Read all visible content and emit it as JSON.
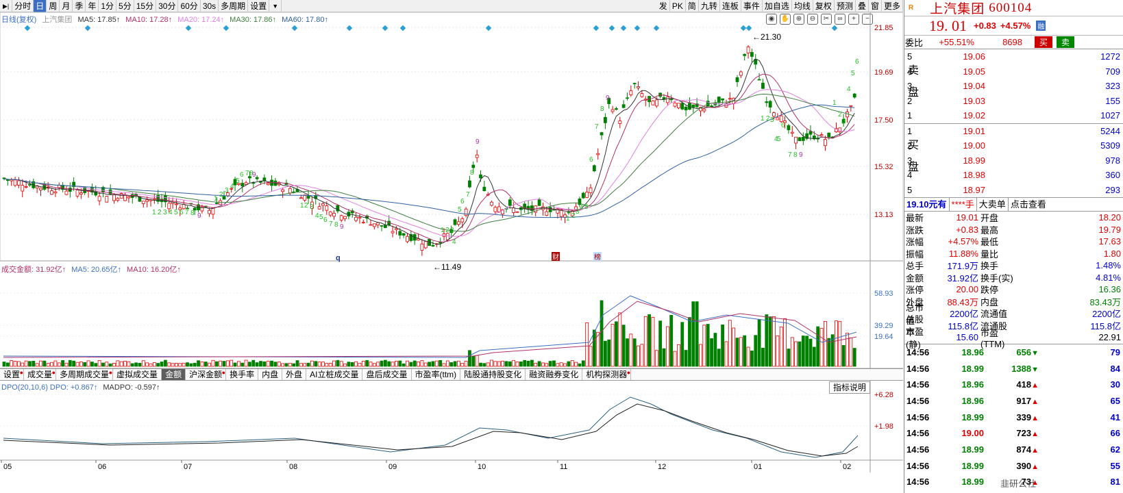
{
  "toolbar": {
    "left_items": [
      "分时",
      "日",
      "周",
      "月",
      "季",
      "年",
      "1分",
      "5分",
      "15分",
      "30分",
      "60分",
      "30s",
      "多周期",
      "设置"
    ],
    "active_index": 1,
    "right_items": [
      "发",
      "PK",
      "简",
      "九转",
      "连板",
      "事件",
      "加自选",
      "均线",
      "复权",
      "预测",
      "叠",
      "窗",
      "更多"
    ]
  },
  "price_legend": {
    "label": "日线(复权)",
    "stock": "上汽集团",
    "ma5": "MA5: 17.85↑",
    "ma10": "MA10: 17.28↑",
    "ma20": "MA20: 17.24↑",
    "ma30": "MA30: 17.86↑",
    "ma60": "MA60: 17.80↑"
  },
  "price_axis": [
    "21.85",
    "19.69",
    "17.50",
    "15.32",
    "13.13"
  ],
  "annotations": {
    "high": "21.30",
    "low": "11.49",
    "letter_q": "q",
    "badge_cai": "财",
    "badge_bang": "榜"
  },
  "volume_legend": {
    "label": "成交金额: 31.92亿↑",
    "ma5": "MA5: 20.65亿↑",
    "ma10": "MA10: 16.20亿↑"
  },
  "volume_axis": [
    "58.93",
    "39.29",
    "19.64"
  ],
  "indicator_tabs": [
    "设置",
    "成交量",
    "多周期成交量",
    "虚拟成交量",
    "金额",
    "沪深金额",
    "换手率",
    "内盘",
    "外盘",
    "AI立桩成交量",
    "盘后成交量",
    "市盈率(ttm)",
    "陆股通持股变化",
    "融资融券变化",
    "机构探测器"
  ],
  "indicator_tab_active": 4,
  "dpo_legend": {
    "label": "DPO(20,10,6) DPO: +0.867↑",
    "madpo": "MADPO: -0.597↑"
  },
  "dpo_axis": [
    "+6.28",
    "+1.98"
  ],
  "help_button": "指标说明",
  "x_axis": [
    "05",
    "06",
    "07",
    "08",
    "09",
    "10",
    "11",
    "12",
    "01",
    "02"
  ],
  "stock": {
    "name": "上汽集团",
    "code": "600104",
    "price": "19. 01",
    "change": "+0.83",
    "pct": "+4.57%",
    "badge": "融",
    "weibi_label": "委比",
    "weibi": "+55.51%",
    "weibi_vol": "8698",
    "buy_btn": "买",
    "sell_btn": "卖"
  },
  "asks": [
    {
      "lvl": "5",
      "price": "19.06",
      "vol": "1272"
    },
    {
      "lvl": "4",
      "price": "19.05",
      "vol": "709"
    },
    {
      "lvl": "3",
      "price": "19.04",
      "vol": "323"
    },
    {
      "lvl": "2",
      "price": "19.03",
      "vol": "155"
    },
    {
      "lvl": "1",
      "price": "19.02",
      "vol": "1027"
    }
  ],
  "bids": [
    {
      "lvl": "1",
      "price": "19.01",
      "vol": "5244"
    },
    {
      "lvl": "2",
      "price": "19.00",
      "vol": "5309"
    },
    {
      "lvl": "3",
      "price": "18.99",
      "vol": "978"
    },
    {
      "lvl": "4",
      "price": "18.98",
      "vol": "360"
    },
    {
      "lvl": "5",
      "price": "18.97",
      "vol": "293"
    }
  ],
  "ask_side_label": [
    "卖",
    "盘"
  ],
  "bid_side_label": [
    "买",
    "盘"
  ],
  "banner": [
    "19.10元有",
    "****手",
    "大卖单",
    "点击查看"
  ],
  "stats": [
    [
      "最新",
      "19.01",
      "开盘",
      "18.20"
    ],
    [
      "涨跌",
      "+0.83",
      "最高",
      "19.79"
    ],
    [
      "涨幅",
      "+4.57%",
      "最低",
      "17.63"
    ],
    [
      "振幅",
      "11.88%",
      "量比",
      "1.80"
    ],
    [
      "总手",
      "171.9万",
      "换手",
      "1.48%"
    ],
    [
      "金额",
      "31.92亿",
      "换手(实)",
      "4.81%"
    ],
    [
      "涨停",
      "20.00",
      "跌停",
      "16.36"
    ],
    [
      "外盘",
      "88.43万",
      "内盘",
      "83.43万"
    ],
    [
      "总市值",
      "2200亿",
      "流通值",
      "2200亿"
    ],
    [
      "总股本",
      "115.8亿",
      "流通股",
      "115.8亿"
    ],
    [
      "市盈(静)",
      "15.60",
      "市盈(TTM)",
      "22.91"
    ]
  ],
  "ticks": [
    {
      "t": "14:56",
      "p": "18.96",
      "v": "656",
      "dir": "dn",
      "c": "79"
    },
    {
      "t": "14:56",
      "p": "18.99",
      "v": "1388",
      "dir": "dn",
      "c": "84"
    },
    {
      "t": "14:56",
      "p": "18.96",
      "v": "418",
      "dir": "up",
      "c": "30"
    },
    {
      "t": "14:56",
      "p": "18.96",
      "v": "917",
      "dir": "up",
      "c": "65"
    },
    {
      "t": "14:56",
      "p": "18.99",
      "v": "339",
      "dir": "up",
      "c": "41"
    },
    {
      "t": "14:56",
      "p": "19.00",
      "v": "723",
      "dir": "up",
      "c": "66"
    },
    {
      "t": "14:56",
      "p": "18.99",
      "v": "874",
      "dir": "up",
      "c": "62"
    },
    {
      "t": "14:56",
      "p": "18.99",
      "v": "390",
      "dir": "up",
      "c": "55"
    },
    {
      "t": "14:56",
      "p": "18.99",
      "v": "73",
      "dir": "up",
      "c": "81"
    }
  ],
  "watermark": "韭研公社",
  "colors": {
    "up": "#e00000",
    "down": "#008000",
    "ma5": "#333333",
    "ma10": "#b0306a",
    "ma20": "#e080e0",
    "ma30": "#3f7f3f",
    "ma60": "#3060a0"
  }
}
